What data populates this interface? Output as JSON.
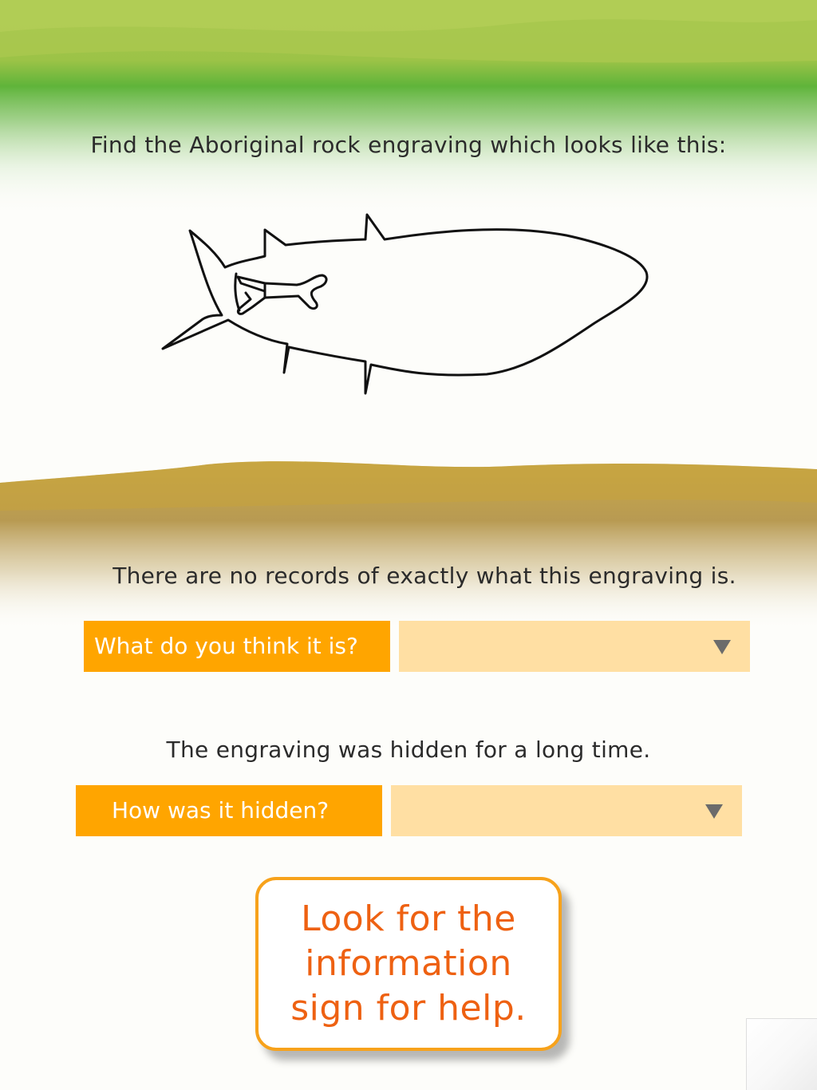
{
  "colors": {
    "label_bg": "#ffa500",
    "select_bg": "#ffdfa3",
    "help_text": "#ee6112",
    "help_border": "#f7a21b",
    "green_band": "#6fba3b",
    "ochre_band": "#c5a445"
  },
  "intro": {
    "prompt": "Find the Aboriginal rock engraving which looks like this:",
    "image_name": "whale-engraving-outline"
  },
  "question1": {
    "context": "There are no records of exactly what this engraving is.",
    "label": "What do you think it is?",
    "selected_value": "",
    "dropdown_icon": "triangle-down-icon"
  },
  "question2": {
    "context": "The engraving was hidden for a long time.",
    "label": "How was it hidden?",
    "selected_value": "",
    "dropdown_icon": "triangle-down-icon"
  },
  "help": {
    "lines": [
      "Look for the",
      "information",
      "sign for help."
    ]
  }
}
